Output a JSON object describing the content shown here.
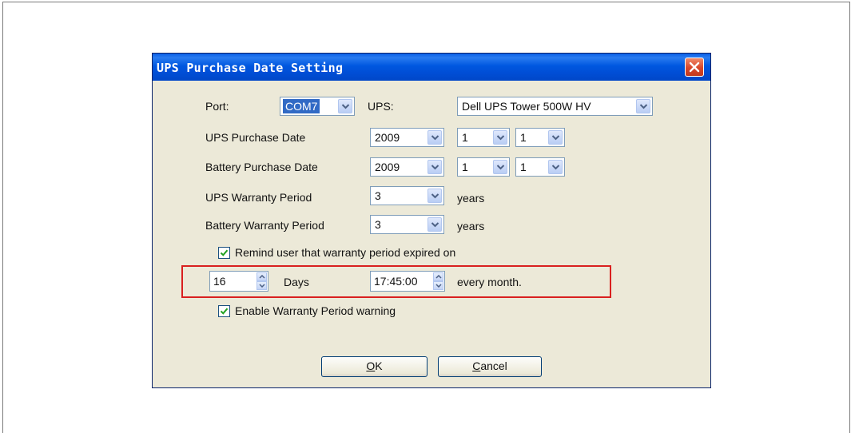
{
  "dialog": {
    "title": "UPS Purchase Date Setting"
  },
  "port": {
    "label": "Port:",
    "value": "COM7"
  },
  "ups": {
    "label": "UPS:",
    "value": "Dell UPS Tower 500W HV"
  },
  "ups_purchase": {
    "label": "UPS Purchase Date",
    "year": "2009",
    "month": "1",
    "day": "1"
  },
  "battery_purchase": {
    "label": "Battery Purchase Date",
    "year": "2009",
    "month": "1",
    "day": "1"
  },
  "ups_warranty": {
    "label": "UPS Warranty Period",
    "value": "3",
    "unit": "years"
  },
  "battery_warranty": {
    "label": "Battery Warranty Period",
    "value": "3",
    "unit": "years"
  },
  "remind": {
    "checked": true,
    "label": "Remind user that warranty period expired on"
  },
  "schedule": {
    "days_value": "16",
    "days_label": "Days",
    "time_value": "17:45:00",
    "suffix": "every month."
  },
  "enable_warning": {
    "checked": true,
    "label": "Enable Warranty Period warning"
  },
  "buttons": {
    "ok": {
      "mnemonic": "O",
      "rest": "K"
    },
    "cancel": {
      "mnemonic": "C",
      "rest": "ancel"
    }
  },
  "colors": {
    "highlight": "#d9201f",
    "title_bar": "#0058e0",
    "dialog_bg": "#ece9d8"
  }
}
